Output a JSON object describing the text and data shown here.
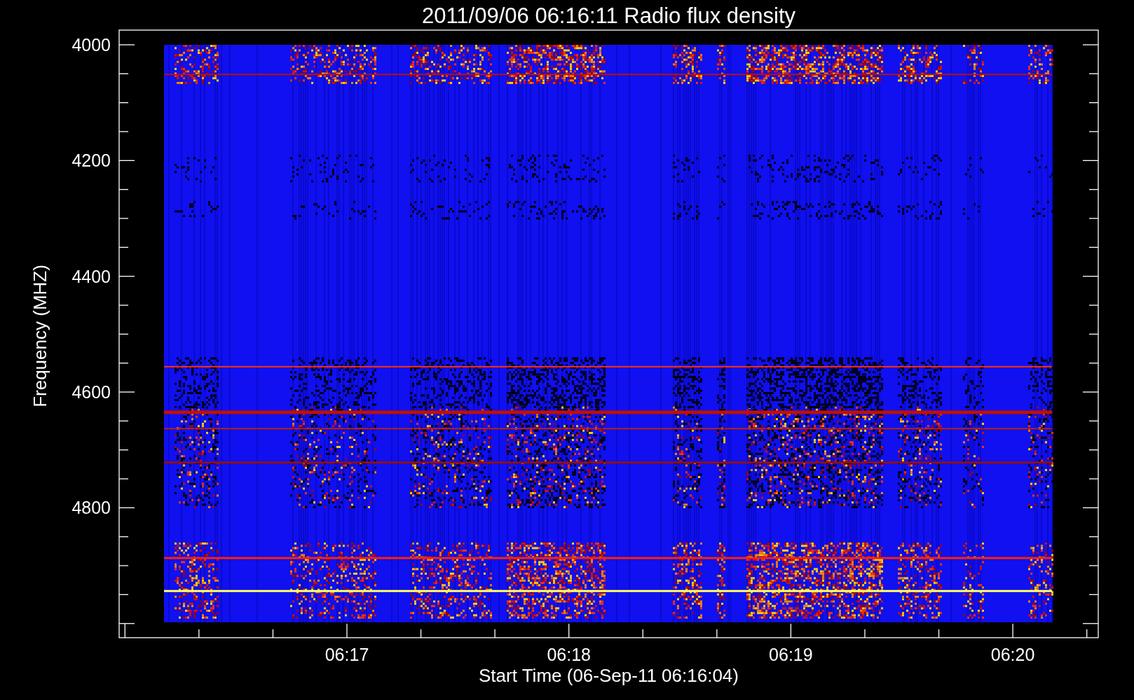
{
  "title": "2011/09/06 06:16:11 Radio flux density",
  "plot": {
    "ylabel": "Frequency (MHZ)",
    "xlabel": "Start Time (06-Sep-11 06:16:04)",
    "yticks": [
      "4000",
      "4200",
      "4400",
      "4600",
      "4800"
    ],
    "xticks": [
      "06:17",
      "06:18",
      "06:19",
      "06:20"
    ]
  }
}
